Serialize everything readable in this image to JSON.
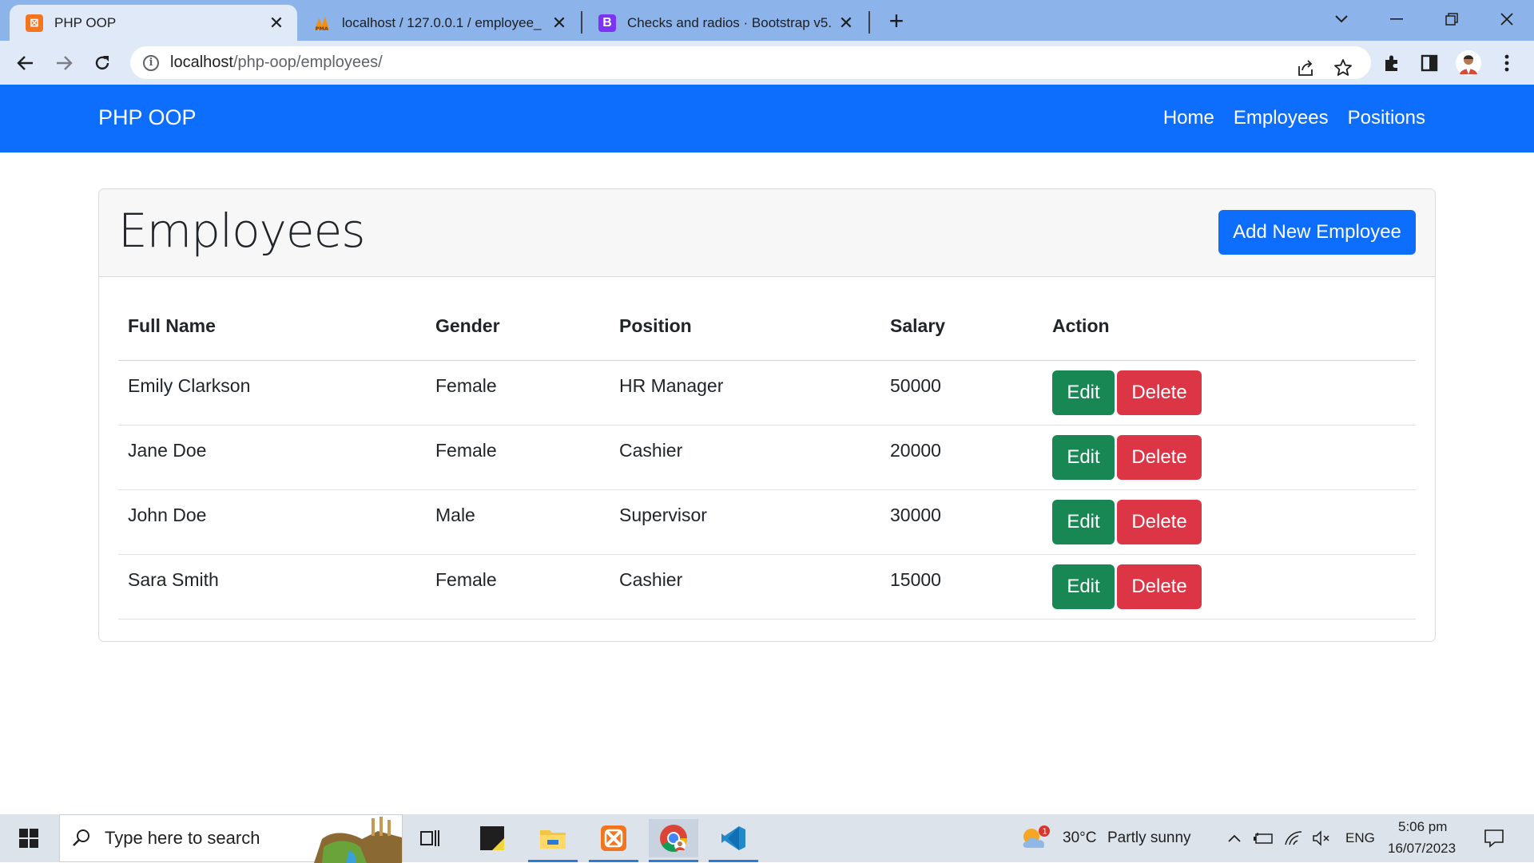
{
  "browser": {
    "tabs": [
      {
        "title": "PHP OOP",
        "favicon": "xampp-icon",
        "active": true
      },
      {
        "title": "localhost / 127.0.0.1 / employee_",
        "favicon": "phpmyadmin-icon",
        "active": false
      },
      {
        "title": "Checks and radios · Bootstrap v5.",
        "favicon": "bootstrap-icon",
        "active": false
      }
    ],
    "url_host": "localhost",
    "url_path": "/php-oop/employees/"
  },
  "navbar": {
    "brand": "PHP OOP",
    "links": [
      "Home",
      "Employees",
      "Positions"
    ]
  },
  "card": {
    "title": "Employees",
    "add_button": "Add New Employee"
  },
  "table": {
    "headers": [
      "Full Name",
      "Gender",
      "Position",
      "Salary",
      "Action"
    ],
    "rows": [
      {
        "name": "Emily Clarkson",
        "gender": "Female",
        "position": "HR Manager",
        "salary": "50000"
      },
      {
        "name": "Jane Doe",
        "gender": "Female",
        "position": "Cashier",
        "salary": "20000"
      },
      {
        "name": "John Doe",
        "gender": "Male",
        "position": "Supervisor",
        "salary": "30000"
      },
      {
        "name": "Sara Smith",
        "gender": "Female",
        "position": "Cashier",
        "salary": "15000"
      }
    ],
    "edit_label": "Edit",
    "delete_label": "Delete"
  },
  "taskbar": {
    "search_placeholder": "Type here to search",
    "weather_temp": "30°C",
    "weather_desc": "Partly sunny",
    "weather_badge": "1",
    "language": "ENG",
    "time": "5:06 pm",
    "date": "16/07/2023"
  },
  "colors": {
    "primary": "#0d6efd",
    "success": "#198754",
    "danger": "#dc3545"
  }
}
